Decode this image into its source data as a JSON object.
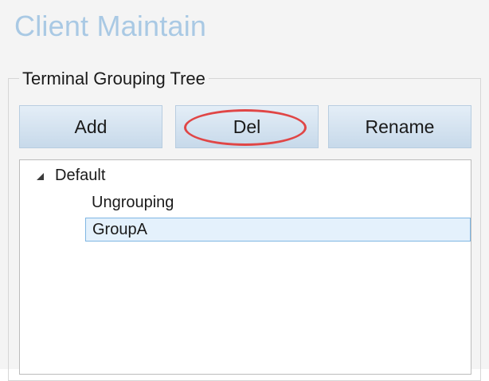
{
  "app": {
    "title": "Client Maintain"
  },
  "groupbox": {
    "title": "Terminal Grouping Tree"
  },
  "toolbar": {
    "add_label": "Add",
    "del_label": "Del",
    "rename_label": "Rename"
  },
  "tree": {
    "root": {
      "label": "Default",
      "expanded": true
    },
    "children": [
      {
        "label": "Ungrouping",
        "selected": false
      },
      {
        "label": "GroupA",
        "selected": true
      }
    ]
  },
  "colors": {
    "title": "#a9c9e4",
    "button_top": "#e4eef7",
    "button_bottom": "#c7d9ea",
    "highlight_ellipse": "#e04646",
    "selection_bg": "#e4f1fc",
    "selection_border": "#7fb6e3"
  },
  "icons": {
    "expand": "expanded-triangle-icon"
  }
}
